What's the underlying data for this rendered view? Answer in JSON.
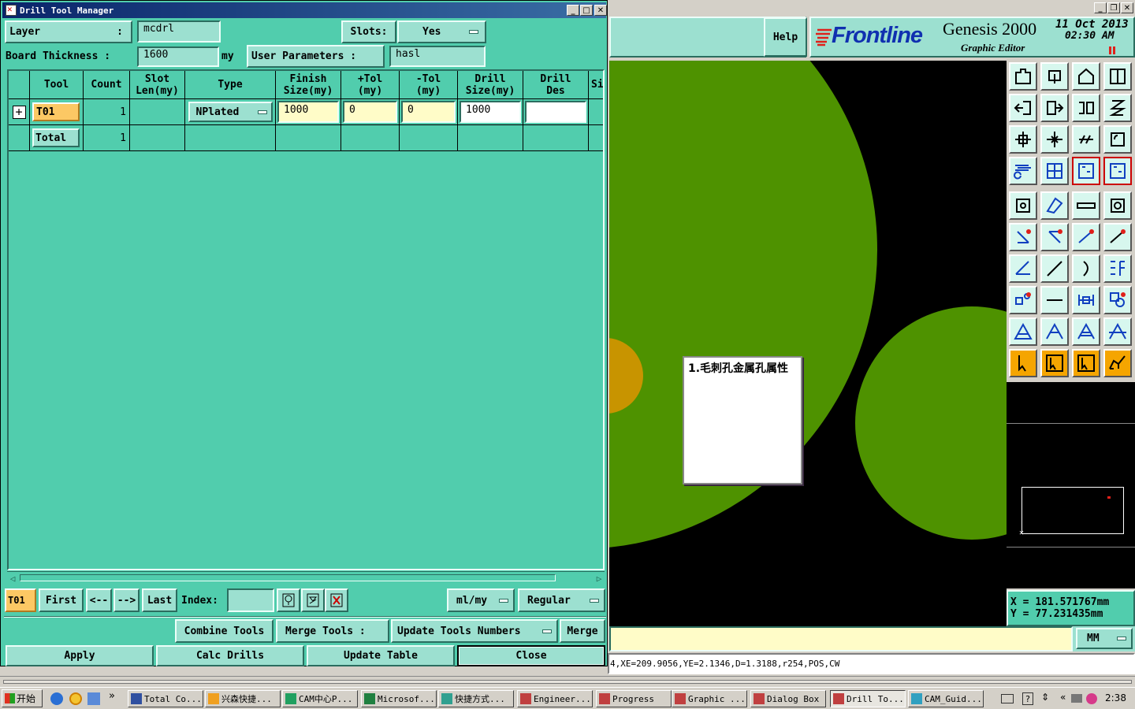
{
  "window": {
    "title": "Drill Tool Manager",
    "minimize": "_",
    "maximize": "□",
    "close": "✕"
  },
  "header": {
    "layer_label": "Layer",
    "layer_colon": ":",
    "layer_value": "mcdrl",
    "slots_label": "Slots:",
    "slots_value": "Yes",
    "board_thickness_label": "Board Thickness :",
    "board_thickness_value": "1600",
    "board_thickness_unit": "my",
    "user_params_label": "User Parameters :",
    "user_params_value": "hasl"
  },
  "table": {
    "columns": [
      "Tool",
      "Count",
      "Slot\nLen(my)",
      "Type",
      "Finish\nSize(my)",
      "+Tol\n(my)",
      "-Tol\n(my)",
      "Drill\nSize(my)",
      "Drill\nDes",
      "Si"
    ],
    "rows": [
      {
        "expand": "+",
        "tool": "T01",
        "count": "1",
        "slot_len": "",
        "type": "NPlated",
        "finish": "1000",
        "ptol": "0",
        "ntol": "0",
        "drill_size": "1000",
        "drill_des": ""
      }
    ],
    "total": {
      "label": "Total",
      "count": "1"
    }
  },
  "navbar": {
    "current_tool": "T01",
    "first": "First",
    "prev": "<--",
    "next": "-->",
    "last": "Last",
    "index_label": "Index:",
    "index_value": "",
    "units": "ml/my",
    "mode": "Regular"
  },
  "actions": {
    "combine_tools": "Combine Tools",
    "merge_tools": "Merge Tools :",
    "update_tools_numbers": "Update Tools Numbers",
    "merge": "Merge",
    "apply": "Apply",
    "calc_drills": "Calc Drills",
    "update_table": "Update Table",
    "close": "Close"
  },
  "graphic_editor": {
    "help": "Help",
    "brand": "Frontline",
    "product": "Genesis 2000",
    "subtitle": "Graphic Editor",
    "date": "11 Oct 2013",
    "time": "02:30 AM",
    "note": "1.毛刺孔金属孔属性",
    "coord_x_label": "X =",
    "coord_x": "181.571767mm",
    "coord_y_label": "Y =",
    "coord_y": "77.231435mm",
    "units_select": "MM",
    "status_line": "4,XE=209.9056,YE=2.1346,D=1.3188,r254,POS,CW",
    "colors": {
      "pad_green": "#4e9200",
      "pad_orange": "#c89400",
      "canvas": "#000000",
      "accent_red": "#e0201a"
    }
  },
  "taskbar": {
    "start": "开始",
    "quick_more": "»",
    "tasks": [
      "Total Co...",
      "兴森快捷...",
      "CAM中心P...",
      "Microsof...",
      "快捷方式...",
      "Engineer...",
      "Progress",
      "Graphic ...",
      "Dialog Box",
      "Drill To...",
      "CAM_Guid..."
    ],
    "tray_more": "«",
    "clock": "2:38"
  }
}
